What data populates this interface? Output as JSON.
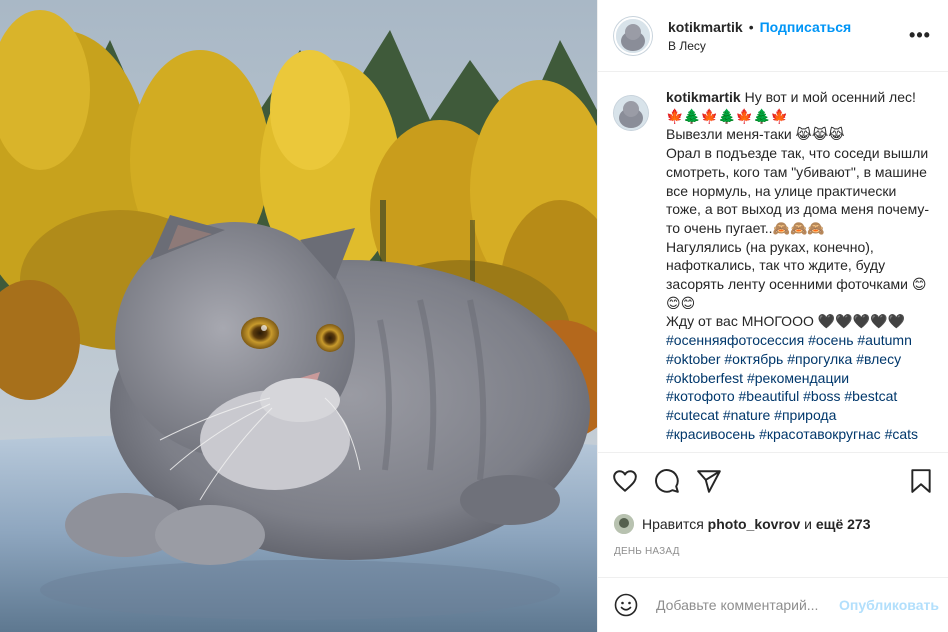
{
  "header": {
    "username": "kotikmartik",
    "separator": "•",
    "follow_label": "Подписаться",
    "location": "В Лесу",
    "more_label": "•••"
  },
  "caption": {
    "username": "kotikmartik",
    "lines": [
      "Ну вот и мой осенний лес!",
      "🍁🌲🍁🌲🍁🌲🍁",
      "Вывезли меня-таки 😹😹😹",
      "Орал в подъезде так, что соседи вышли смотреть, кого там \"убивают\", в машине все нормуль, на улице практически тоже, а вот выход из дома меня почему-то очень пугает..🙈🙈🙈",
      "Нагулялись (на руках, конечно), нафоткались, так что ждите, буду засорять ленту осенними фоточками 😊😊😊",
      "Жду от вас МНОГООО 🖤🖤🖤🖤🖤"
    ],
    "hashtags": [
      "#осенняяфотосессия #осень #autumn",
      "#oktober #октябрь #прогулка #влесу",
      "#oktoberfest #рекомендации",
      "#котофото #beautiful #boss #bestcat",
      "#cutecat #nature #природа",
      "#красивосень #красотавокругнас #cats"
    ]
  },
  "actions": {
    "like_icon": "heart-icon",
    "comment_icon": "comment-icon",
    "share_icon": "share-icon",
    "save_icon": "bookmark-icon"
  },
  "likes": {
    "prefix": "Нравится",
    "user": "photo_kovrov",
    "and": "и",
    "others": "ещё 273"
  },
  "timestamp": "День назад",
  "comment": {
    "placeholder": "Добавьте комментарий...",
    "post_label": "Опубликовать"
  },
  "colors": {
    "accent": "#0095f6",
    "hashtag": "#00376b",
    "post_disabled": "#b2dffc",
    "muted": "#8e8e8e"
  }
}
